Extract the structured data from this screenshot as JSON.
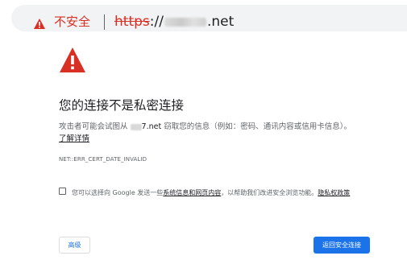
{
  "address_bar": {
    "security_label": "不安全",
    "url_scheme": "https",
    "url_separator": "://",
    "url_host_visible": ".net",
    "security_color": "#d93025"
  },
  "interstitial": {
    "warning_icon": "warning-triangle-icon",
    "heading": "您的连接不是私密连接",
    "description_prefix": "攻击者可能会试图从",
    "description_host_visible": "7.net",
    "description_suffix": "窃取您的信息（例如：密码、通讯内容或信用卡信息）。",
    "learn_more": "了解详情",
    "error_code": "NET::ERR_CERT_DATE_INVALID",
    "optin": {
      "text_before": "您可以选择向 Google 发送一些",
      "link1": "系统信息和网页内容",
      "text_middle": "，以帮助我们改进安全浏览功能。",
      "link2": "隐私权政策",
      "checked": false
    },
    "buttons": {
      "advanced": "高级",
      "back_to_safety": "返回安全连接"
    },
    "accent_color": "#1a73e8"
  }
}
